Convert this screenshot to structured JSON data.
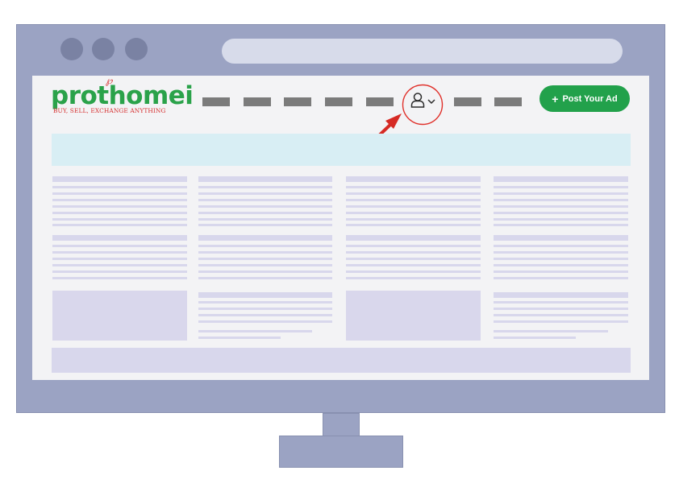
{
  "brand": {
    "name": "prothomei",
    "tagline": "BUY, SELL, EXCHANGE ANYTHING",
    "mark_glyph": "℘",
    "primary_color": "#2aa24a",
    "accent_color": "#d63030"
  },
  "header": {
    "post_ad_label": "Post Your Ad",
    "post_ad_icon": "plus-icon",
    "account_icon": "user-icon",
    "account_dropdown_icon": "chevron-down-icon",
    "highlight_color": "#e0302a"
  },
  "window_controls": [
    "control-dot",
    "control-dot",
    "control-dot"
  ]
}
